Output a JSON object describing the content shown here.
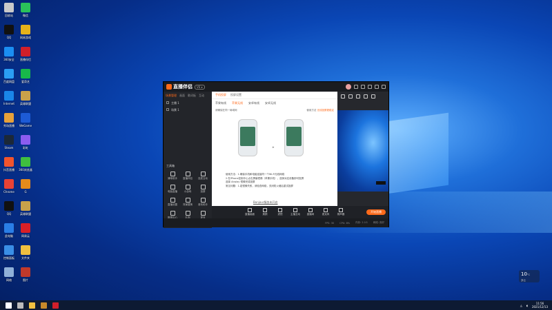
{
  "desktop_icons": [
    {
      "label": "回收站",
      "color": "#c9c9c9"
    },
    {
      "label": "微信",
      "color": "#2ac15a"
    },
    {
      "label": "QQ",
      "color": "#111111"
    },
    {
      "label": "网易游戏",
      "color": "#e6b21a"
    },
    {
      "label": "360安全",
      "color": "#1b8ef2"
    },
    {
      "label": "直播伴侣",
      "color": "#d11f2a"
    },
    {
      "label": "百度网盘",
      "color": "#2a9df4"
    },
    {
      "label": "爱奇艺",
      "color": "#18b84a"
    },
    {
      "label": "Internet",
      "color": "#1a86e8"
    },
    {
      "label": "英雄联盟",
      "color": "#c8a24a"
    },
    {
      "label": "秀场直播",
      "color": "#e7a13a"
    },
    {
      "label": "WeGame",
      "color": "#1d5bd6"
    },
    {
      "label": "Steam",
      "color": "#1b2838"
    },
    {
      "label": "彩虹",
      "color": "#8c5cf0"
    },
    {
      "label": "抖音直播",
      "color": "#f2542d"
    },
    {
      "label": "360浏览器",
      "color": "#3fbf3f"
    },
    {
      "label": "Chrome",
      "color": "#e94235"
    },
    {
      "label": "G",
      "color": "#e58b1c"
    },
    {
      "label": "QQ",
      "color": "#111111"
    },
    {
      "label": "英雄联盟",
      "color": "#c8a24a"
    },
    {
      "label": "此电脑",
      "color": "#2a7ee6"
    },
    {
      "label": "网易云",
      "color": "#d91f26"
    },
    {
      "label": "控制面板",
      "color": "#3a8ee6"
    },
    {
      "label": "文件夹",
      "color": "#f0c040"
    },
    {
      "label": "网络",
      "color": "#8fb0d8"
    },
    {
      "label": "图片",
      "color": "#c0392b"
    }
  ],
  "app": {
    "name": "直播伴侣",
    "version": "V6 ▾",
    "left_tabs": [
      "场景管理",
      "画面",
      "歌词板",
      "互动"
    ],
    "scenes": [
      "主播 1",
      "场景 1"
    ],
    "tools_header": "工具箱",
    "tools": [
      "清晰助手",
      "直播伴侣",
      "连麦互动",
      "电脑直播",
      "小游戏",
      "投屏",
      "直播设置",
      "背景替换",
      "音效助手",
      "数据中心",
      "礼物",
      "更多"
    ],
    "left_footer": "你有新的礼物已送达直播伴侣 ▸",
    "center_tabs": [
      "手机投屏",
      "投屏设置"
    ],
    "modes": [
      "苹果有线",
      "苹果无线",
      "安卓有线",
      "安卓无线"
    ],
    "hint_left": "请确保在同一局域网",
    "hint_right_prefix": "使用方法",
    "hint_link": "无线投屏更稳定",
    "instructions": [
      "使用方法：1.确保手机和电脑连接同一个Wi-Fi无线网络",
      "2.在iPhone控制中心点击屏幕镜像（苹果手机），选择对应设备即可投屏",
      "选择 Airplay 镜像完成投屏",
      "常见问题：1.若镜像失败，请检查网络，关闭防火墙后重试投屏"
    ],
    "center_footer": "Bonjour服务未开启",
    "bottom_buttons": [
      "直播画面",
      "美颜",
      "滤镜",
      "主播互动",
      "直播间",
      "麦克风",
      "扬声器"
    ],
    "go_live": "开始直播",
    "status": [
      "FPS: 30",
      "CPU: 8%",
      "内存: 2.1G",
      "网络: 良好"
    ]
  },
  "widget": {
    "temp": "10",
    "unit": "°C",
    "desc": "多云"
  },
  "taskbar": {
    "time": "11:56",
    "date": "2021/12/13",
    "icons": [
      {
        "name": "start",
        "color": "#ffffff"
      },
      {
        "name": "search",
        "color": "#bbbbbb"
      },
      {
        "name": "explorer",
        "color": "#f0c040"
      },
      {
        "name": "app1",
        "color": "#c78a2a"
      },
      {
        "name": "app2",
        "color": "#d11f2a"
      }
    ]
  }
}
